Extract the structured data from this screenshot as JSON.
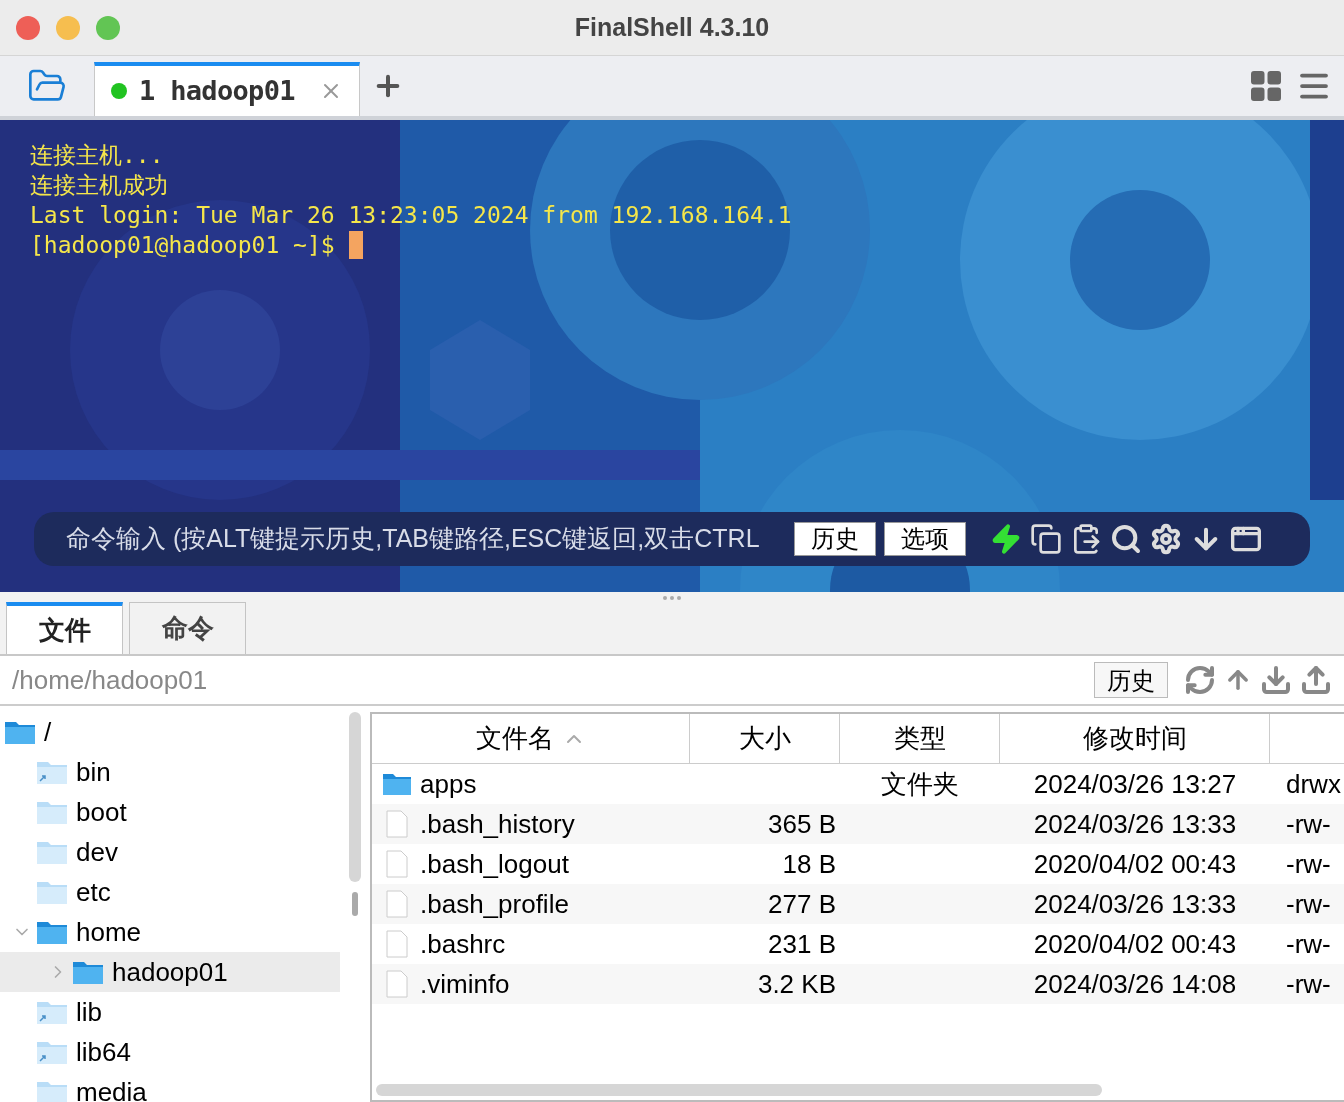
{
  "window": {
    "title": "FinalShell 4.3.10"
  },
  "session_tabs": [
    {
      "label": "1 hadoop01",
      "selected": true,
      "connected": true
    }
  ],
  "terminal": {
    "lines": [
      "连接主机...",
      "连接主机成功",
      "Last login: Tue Mar 26 13:23:05 2024 from 192.168.164.1"
    ],
    "prompt": "[hadoop01@hadoop01 ~]$ "
  },
  "command_bar": {
    "placeholder": "命令输入 (按ALT键提示历史,TAB键路径,ESC键返回,双击CTRL",
    "buttons": [
      "历史",
      "选项"
    ]
  },
  "panel_tabs": [
    {
      "label": "文件",
      "selected": true
    },
    {
      "label": "命令",
      "selected": false
    }
  ],
  "path": {
    "value": "/home/hadoop01",
    "history_button": "历史"
  },
  "tree": [
    {
      "name": "/",
      "kind": "dir",
      "on_path": true,
      "selected": false,
      "children": [
        {
          "name": "bin",
          "kind": "link",
          "on_path": false,
          "selected": false
        },
        {
          "name": "boot",
          "kind": "dir",
          "on_path": false,
          "selected": false
        },
        {
          "name": "dev",
          "kind": "dir",
          "on_path": false,
          "selected": false
        },
        {
          "name": "etc",
          "kind": "dir",
          "on_path": false,
          "selected": false
        },
        {
          "name": "home",
          "kind": "dir",
          "on_path": true,
          "expanded": true,
          "selected": false,
          "children": [
            {
              "name": "hadoop01",
              "kind": "dir",
              "on_path": true,
              "expanded": false,
              "selected": true
            }
          ]
        },
        {
          "name": "lib",
          "kind": "link",
          "on_path": false,
          "selected": false
        },
        {
          "name": "lib64",
          "kind": "link",
          "on_path": false,
          "selected": false
        },
        {
          "name": "media",
          "kind": "dir",
          "on_path": false,
          "selected": false
        }
      ]
    }
  ],
  "table": {
    "columns": [
      {
        "label": "文件名",
        "sorted": true
      },
      {
        "label": "大小",
        "sorted": false
      },
      {
        "label": "类型",
        "sorted": false
      },
      {
        "label": "修改时间",
        "sorted": false
      }
    ],
    "rows": [
      {
        "kind": "folder",
        "name": "apps",
        "size": "",
        "type": "文件夹",
        "modified": "2024/03/26 13:27",
        "column_5": "drwx"
      },
      {
        "kind": "file",
        "name": ".bash_history",
        "size": "365 B",
        "type": "",
        "modified": "2024/03/26 13:33",
        "column_5": "-rw-"
      },
      {
        "kind": "file",
        "name": ".bash_logout",
        "size": "18 B",
        "type": "",
        "modified": "2020/04/02 00:43",
        "column_5": "-rw-"
      },
      {
        "kind": "file",
        "name": ".bash_profile",
        "size": "277 B",
        "type": "",
        "modified": "2024/03/26 13:33",
        "column_5": "-rw-"
      },
      {
        "kind": "file",
        "name": ".bashrc",
        "size": "231 B",
        "type": "",
        "modified": "2020/04/02 00:43",
        "column_5": "-rw-"
      },
      {
        "kind": "file",
        "name": ".viminfo",
        "size": "3.2 KB",
        "type": "",
        "modified": "2024/03/26 14:08",
        "column_5": "-rw-"
      }
    ]
  }
}
